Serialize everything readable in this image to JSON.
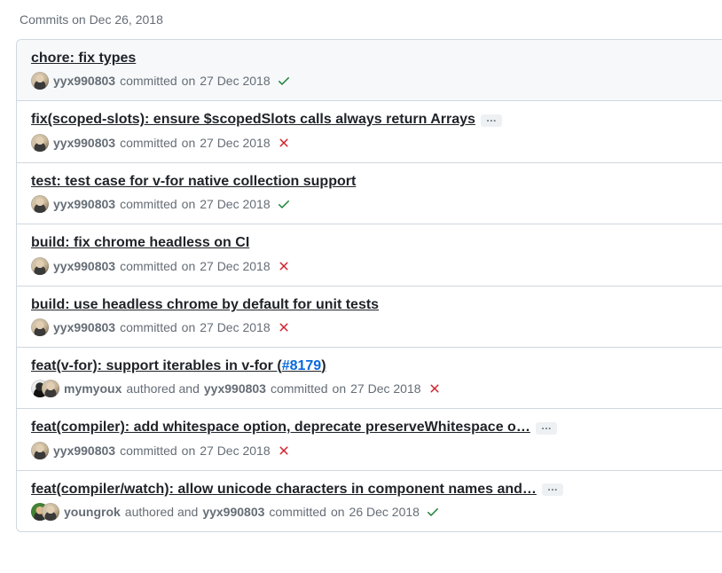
{
  "group": {
    "heading": "Commits on Dec 26, 2018"
  },
  "meta": {
    "authored_word": "authored",
    "and_word": "and",
    "committed_word": "committed",
    "on_word": "on"
  },
  "commits": [
    {
      "title": "chore: fix types",
      "has_ellipsis": false,
      "selected": true,
      "authors": [
        {
          "login": "yyx990803",
          "avatar_class": "av-yyx"
        }
      ],
      "committer": null,
      "date": "27 Dec 2018",
      "status": "success"
    },
    {
      "title": "fix(scoped-slots): ensure $scopedSlots calls always return Arrays",
      "has_ellipsis": true,
      "selected": false,
      "authors": [
        {
          "login": "yyx990803",
          "avatar_class": "av-yyx"
        }
      ],
      "committer": null,
      "date": "27 Dec 2018",
      "status": "failure"
    },
    {
      "title": "test: test case for v-for native collection support",
      "has_ellipsis": false,
      "selected": false,
      "authors": [
        {
          "login": "yyx990803",
          "avatar_class": "av-yyx"
        }
      ],
      "committer": null,
      "date": "27 Dec 2018",
      "status": "success"
    },
    {
      "title": "build: fix chrome headless on CI",
      "has_ellipsis": false,
      "selected": false,
      "authors": [
        {
          "login": "yyx990803",
          "avatar_class": "av-yyx"
        }
      ],
      "committer": null,
      "date": "27 Dec 2018",
      "status": "failure"
    },
    {
      "title": "build: use headless chrome by default for unit tests",
      "has_ellipsis": false,
      "selected": false,
      "authors": [
        {
          "login": "yyx990803",
          "avatar_class": "av-yyx"
        }
      ],
      "committer": null,
      "date": "27 Dec 2018",
      "status": "failure"
    },
    {
      "title_parts": {
        "before": "feat(v-for): support iterables in v-for (",
        "issue": "#8179",
        "after": ")"
      },
      "has_ellipsis": false,
      "selected": false,
      "authors": [
        {
          "login": "mymyoux",
          "avatar_class": "av-mymyoux"
        }
      ],
      "committer": {
        "login": "yyx990803",
        "avatar_class": "av-yyx"
      },
      "date": "27 Dec 2018",
      "status": "failure"
    },
    {
      "title": "feat(compiler): add whitespace option, deprecate preserveWhitespace o…",
      "has_ellipsis": true,
      "selected": false,
      "authors": [
        {
          "login": "yyx990803",
          "avatar_class": "av-yyx"
        }
      ],
      "committer": null,
      "date": "27 Dec 2018",
      "status": "failure"
    },
    {
      "title": "feat(compiler/watch): allow unicode characters in component names and…",
      "has_ellipsis": true,
      "selected": false,
      "authors": [
        {
          "login": "youngrok",
          "avatar_class": "av-youngrok"
        }
      ],
      "committer": {
        "login": "yyx990803",
        "avatar_class": "av-yyx"
      },
      "date": "26 Dec 2018",
      "status": "success"
    }
  ]
}
